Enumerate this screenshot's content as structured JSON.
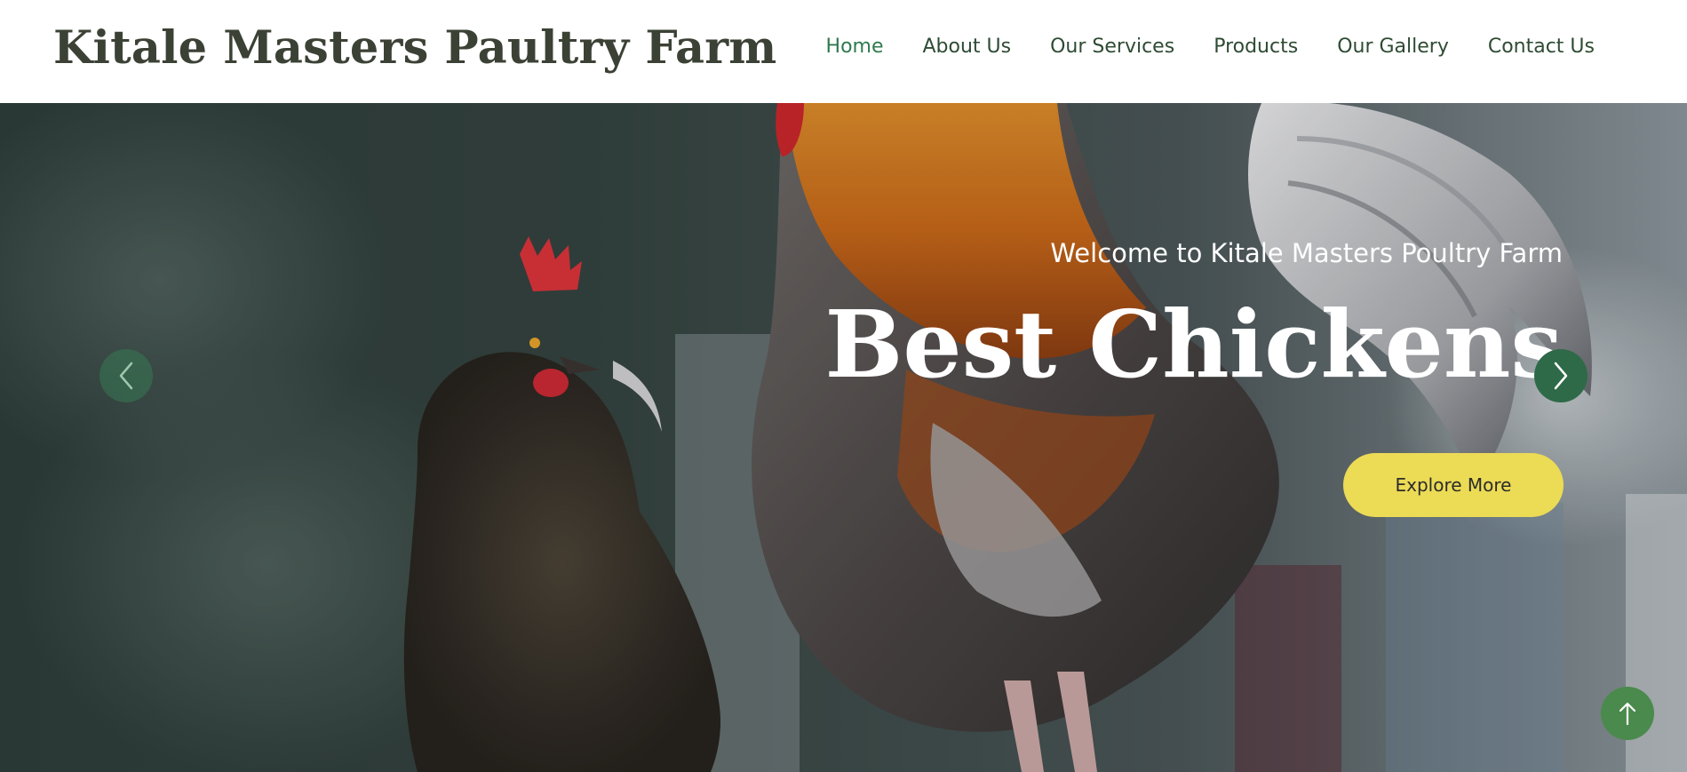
{
  "header": {
    "brand": "Kitale Masters Paultry Farm",
    "nav": [
      {
        "label": "Home",
        "active": true
      },
      {
        "label": "About Us"
      },
      {
        "label": "Our Services"
      },
      {
        "label": "Products"
      },
      {
        "label": "Our Gallery"
      },
      {
        "label": "Contact Us"
      }
    ]
  },
  "hero": {
    "welcome": "Welcome to Kitale Masters Poultry Farm",
    "headline": "Best Chickens",
    "cta_label": "Explore More"
  },
  "icons": {
    "prev": "chevron-left-icon",
    "next": "chevron-right-icon",
    "back_to_top": "arrow-up-icon"
  },
  "colors": {
    "brand_text": "#3b4235",
    "nav_text": "#2e4b33",
    "nav_active": "#2f7a4f",
    "cta_bg": "#ecdb55",
    "arrow_bg": "#2f6a48",
    "to_top_bg": "#4a8a4c"
  }
}
